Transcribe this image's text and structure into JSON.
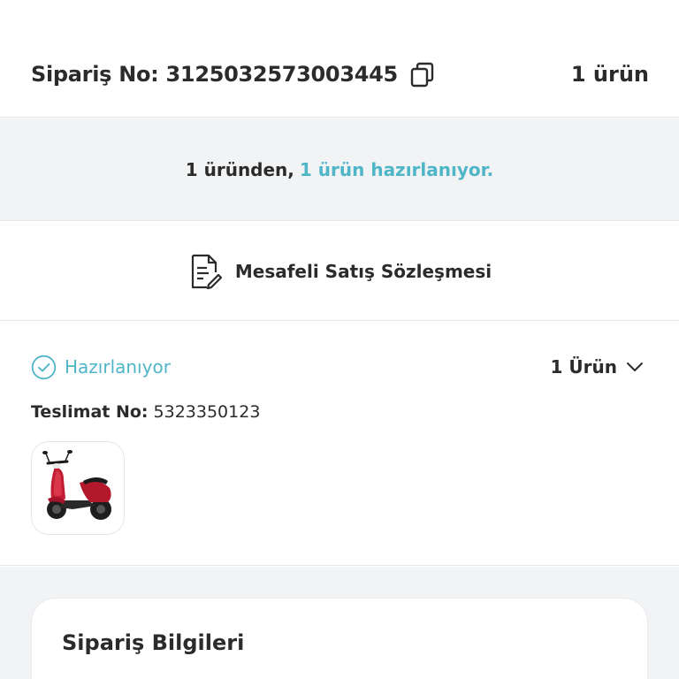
{
  "order": {
    "label": "Sipariş No:",
    "number": "3125032573003445",
    "count_label": "1 ürün"
  },
  "status_banner": {
    "prefix": "1 üründen,",
    "highlight": "1 ürün hazırlanıyor."
  },
  "contract": {
    "label": "Mesafeli Satış Sözleşmesi"
  },
  "shipment": {
    "status": "Hazırlanıyor",
    "count_label": "1 Ürün",
    "delivery_label": "Teslimat No:",
    "delivery_number": "5323350123",
    "product_image": "red-scooter"
  },
  "info": {
    "title": "Sipariş Bilgileri"
  },
  "colors": {
    "accent": "#4fb6c8",
    "text": "#2b2b2b",
    "background_gray": "#f2f3f5"
  }
}
